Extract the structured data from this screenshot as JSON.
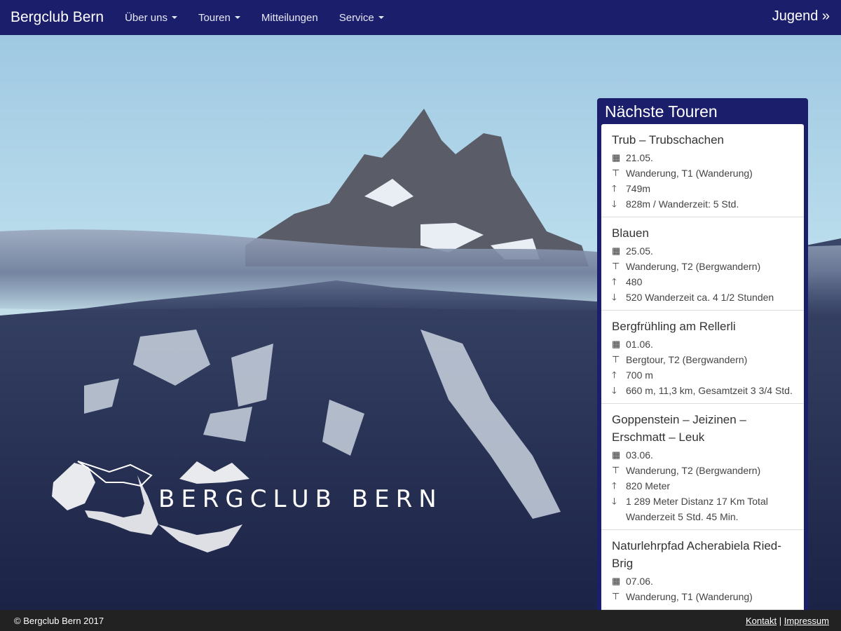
{
  "nav": {
    "brand": "Bergclub Bern",
    "items": [
      {
        "label": "Über uns",
        "dropdown": true
      },
      {
        "label": "Touren",
        "dropdown": true
      },
      {
        "label": "Mitteilungen",
        "dropdown": false
      },
      {
        "label": "Service",
        "dropdown": true
      }
    ],
    "jugend": "Jugend »"
  },
  "hero": {
    "logo_text": "BERGCLUB BERN"
  },
  "panel": {
    "title": "Nächste Touren",
    "tours": [
      {
        "title": "Trub – Trubschachen",
        "date": "21.05.",
        "type": "Wanderung, T1 (Wanderung)",
        "up": "749m",
        "down": "828m / Wanderzeit: 5 Std."
      },
      {
        "title": "Blauen",
        "date": "25.05.",
        "type": "Wanderung, T2 (Bergwandern)",
        "up": "480",
        "down": "520 Wanderzeit ca. 4 1/2 Stunden"
      },
      {
        "title": "Bergfrühling am Rellerli",
        "date": "01.06.",
        "type": "Bergtour, T2 (Bergwandern)",
        "up": "700 m",
        "down": "660 m, 11,3 km, Gesamtzeit 3 3/4 Std."
      },
      {
        "title": "Goppenstein – Jeizinen – Erschmatt – Leuk",
        "date": "03.06.",
        "type": "Wanderung, T2 (Bergwandern)",
        "up": "820 Meter",
        "down": "1 289 Meter Distanz 17 Km Total Wanderzeit 5 Std. 45 Min."
      },
      {
        "title": "Naturlehrpfad Acherabiela Ried-Brig",
        "date": "07.06.",
        "type": "Wanderung, T1 (Wanderung)",
        "up": "",
        "down": ""
      }
    ],
    "icons": {
      "date": "calendar-icon",
      "type": "signpost-icon",
      "up": "arrow-up-icon",
      "down": "arrow-down-icon"
    }
  },
  "footer": {
    "copyright": "© Bergclub Bern 2017",
    "links": [
      "Kontakt",
      "Impressum"
    ],
    "separator": "|"
  },
  "colors": {
    "navbar": "#1b1f6b",
    "footer": "#222222",
    "panel": "#1b1f6b"
  }
}
